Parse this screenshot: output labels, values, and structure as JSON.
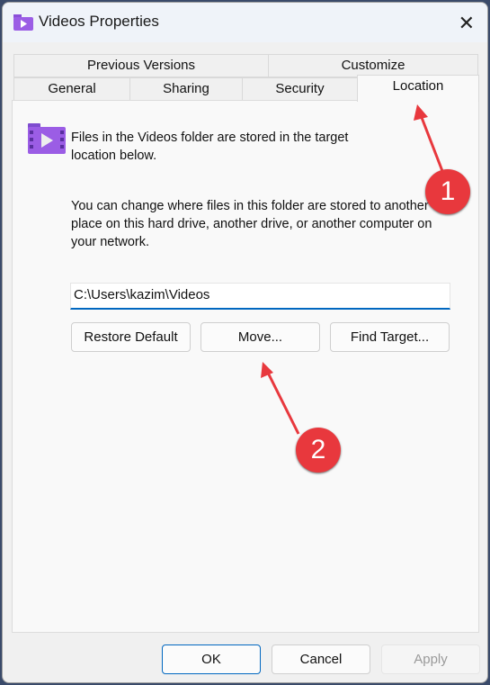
{
  "window": {
    "title": "Videos Properties",
    "close_icon": "close-icon"
  },
  "tabs": {
    "row1": [
      "Previous Versions",
      "Customize"
    ],
    "row2": [
      "General",
      "Sharing",
      "Security",
      "Location"
    ],
    "selected": "Location"
  },
  "location": {
    "info": "Files in the Videos folder are stored in the target location below.",
    "description": "You can change where files in this folder are stored to another place on this hard drive, another drive, or another computer on your network.",
    "path": "C:\\Users\\kazim\\Videos",
    "restore_default": "Restore Default",
    "move": "Move...",
    "find_target": "Find Target..."
  },
  "footer": {
    "ok": "OK",
    "cancel": "Cancel",
    "apply": "Apply"
  },
  "annotations": {
    "badge1": "1",
    "badge2": "2",
    "color": "#e8383d"
  }
}
